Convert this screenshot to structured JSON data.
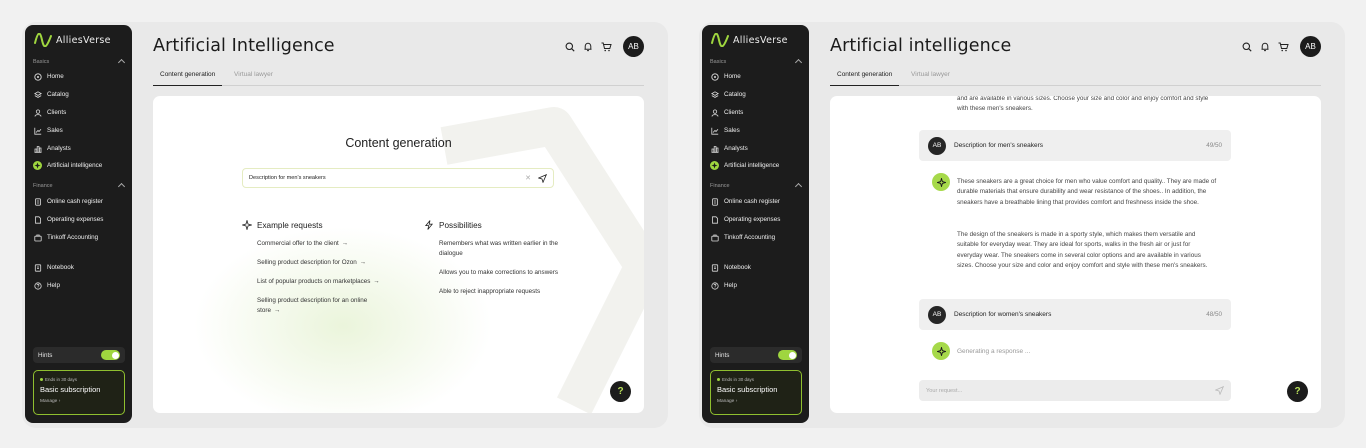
{
  "brand": {
    "name": "AlliesVerse",
    "accent": "#9fd63f"
  },
  "sidebar": {
    "basics_label": "Basics",
    "finance_label": "Finance",
    "basics_items": [
      {
        "label": "Home",
        "icon": "home-icon"
      },
      {
        "label": "Catalog",
        "icon": "catalog-icon"
      },
      {
        "label": "Clients",
        "icon": "user-icon"
      },
      {
        "label": "Sales",
        "icon": "chart-icon"
      },
      {
        "label": "Analysts",
        "icon": "bar-chart-icon"
      },
      {
        "label": "Artificial intelligence",
        "icon": "sparkle-icon",
        "active": true
      }
    ],
    "finance_items": [
      {
        "label": "Online cash register",
        "icon": "register-icon"
      },
      {
        "label": "Operating expenses",
        "icon": "document-icon"
      },
      {
        "label": "Tinkoff Accounting",
        "icon": "briefcase-icon"
      }
    ],
    "extra_items": [
      {
        "label": "Notebook",
        "icon": "notebook-icon"
      },
      {
        "label": "Help",
        "icon": "help-icon"
      }
    ],
    "hints_label": "Hints",
    "hints_on": true,
    "subscription": {
      "ends": "Ends in 30 days",
      "title": "Basic subscription",
      "manage": "Manage"
    }
  },
  "screen1": {
    "title": "Artificial Intelligence",
    "avatar": "AB",
    "tabs": [
      "Content generation",
      "Virtual lawyer"
    ],
    "panel_title": "Content generation",
    "search_value": "Description for men's sneakers",
    "examples_title": "Example requests",
    "examples": [
      "Commercial offer to the client",
      "Selling product description for Ozon",
      "List of popular products on marketplaces",
      "Selling product description for an online store"
    ],
    "possibilities_title": "Possibilities",
    "possibilities": [
      "Remembers what was written earlier in the dialogue",
      "Allows you to make corrections to answers",
      "Able to reject inappropriate requests"
    ],
    "help": "?"
  },
  "screen2": {
    "title": "Artificial intelligence",
    "avatar": "AB",
    "tabs": [
      "Content generation",
      "Virtual lawyer"
    ],
    "scrolled_text": "and are available in various sizes. Choose your size and color and enjoy comfort and style with these men's sneakers.",
    "user_msg_1": {
      "avatar": "AB",
      "text": "Description for men's sneakers",
      "count": "49/50"
    },
    "bot_reply_p1": "These sneakers are a great choice for men who value comfort and quality.. They are made of durable materials that ensure durability and wear resistance of the shoes.. In addition, the sneakers have a breathable lining that provides comfort and freshness inside the shoe.",
    "bot_reply_p2": "The design of the sneakers is made in a sporty style, which makes them versatile and suitable for everyday wear. They are ideal for sports, walks in the fresh air or just for everyday wear. The sneakers come in several color options and are available in various sizes. Choose your size and color and enjoy comfort and style with these men's sneakers.",
    "user_msg_2": {
      "avatar": "AB",
      "text": "Description for women's sneakers",
      "count": "48/50"
    },
    "generating": "Generating a response ...",
    "input_placeholder": "Your request...",
    "help": "?"
  }
}
